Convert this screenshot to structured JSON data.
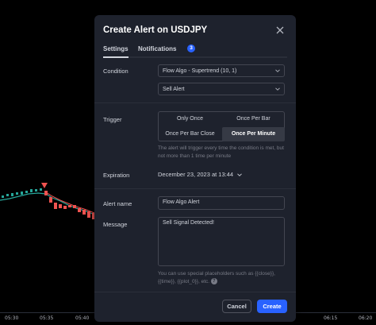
{
  "dialog": {
    "title": "Create Alert on USDJPY",
    "tabs": [
      {
        "label": "Settings"
      },
      {
        "label": "Notifications",
        "badge": "3"
      }
    ]
  },
  "condition": {
    "label": "Condition",
    "indicator": "Flow Algo - Supertrend (10, 1)",
    "alert_type": "Sell Alert"
  },
  "trigger": {
    "label": "Trigger",
    "options": [
      "Only Once",
      "Once Per Bar",
      "Once Per Bar Close",
      "Once Per Minute"
    ],
    "selected": "Once Per Minute",
    "help": "The alert will trigger every time the condition is met, but not more than 1 time per minute"
  },
  "expiration": {
    "label": "Expiration",
    "value": "December 23, 2023 at 13:44"
  },
  "alert_name": {
    "label": "Alert name",
    "value": "Flow Algo Alert"
  },
  "message": {
    "label": "Message",
    "value": "Sell Signal Detected!",
    "help": "You can use special placeholders such as {{close}}, {{time}}, {{plot_0}}, etc."
  },
  "buttons": {
    "cancel": "Cancel",
    "create": "Create"
  },
  "time_axis": [
    "05:30",
    "05:35",
    "05:40",
    "06:15",
    "06:20"
  ],
  "colors": {
    "accent": "#2962ff",
    "bull_candle": "#26a69a",
    "bear_candle": "#ef5350",
    "dialog_bg": "#1e222d"
  }
}
